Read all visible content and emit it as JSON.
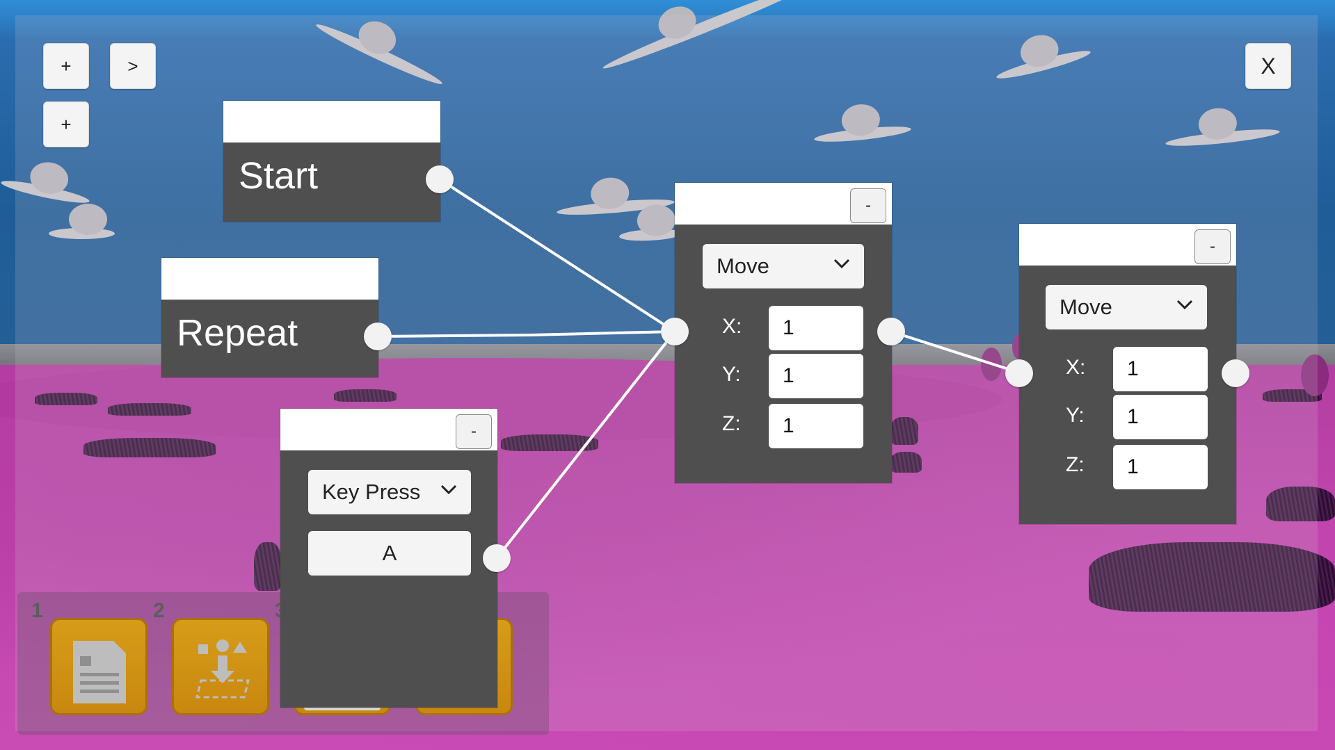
{
  "toolbar": {
    "add_label_1": "+",
    "next_label": ">",
    "add_label_2": "+",
    "close_label": "X"
  },
  "hotbar": {
    "slots": [
      {
        "number": "1",
        "icon": "document-icon"
      },
      {
        "number": "2",
        "icon": "place-block-icon"
      },
      {
        "number": "3",
        "icon": "slot-3"
      },
      {
        "number": "",
        "icon": "slot-4"
      }
    ]
  },
  "nodes": {
    "start": {
      "title": "Start"
    },
    "repeat": {
      "title": "Repeat"
    },
    "key_press": {
      "collapse_label": "-",
      "dropdown_value": "Key Press",
      "key_value": "A"
    },
    "move_1": {
      "collapse_label": "-",
      "dropdown_value": "Move",
      "x_label": "X:",
      "x_value": "1",
      "y_label": "Y:",
      "y_value": "1",
      "z_label": "Z:",
      "z_value": "1"
    },
    "move_2": {
      "collapse_label": "-",
      "dropdown_value": "Move",
      "x_label": "X:",
      "x_value": "1",
      "y_label": "Y:",
      "y_value": "1",
      "z_label": "Z:",
      "z_value": "1"
    }
  },
  "colors": {
    "node_body": "#4f4f4f",
    "node_header": "#ffffff",
    "wire": "#ffffff",
    "hotbar_slot": "#d79c19",
    "ground": "#b43ea2",
    "sky": "#245f96"
  }
}
